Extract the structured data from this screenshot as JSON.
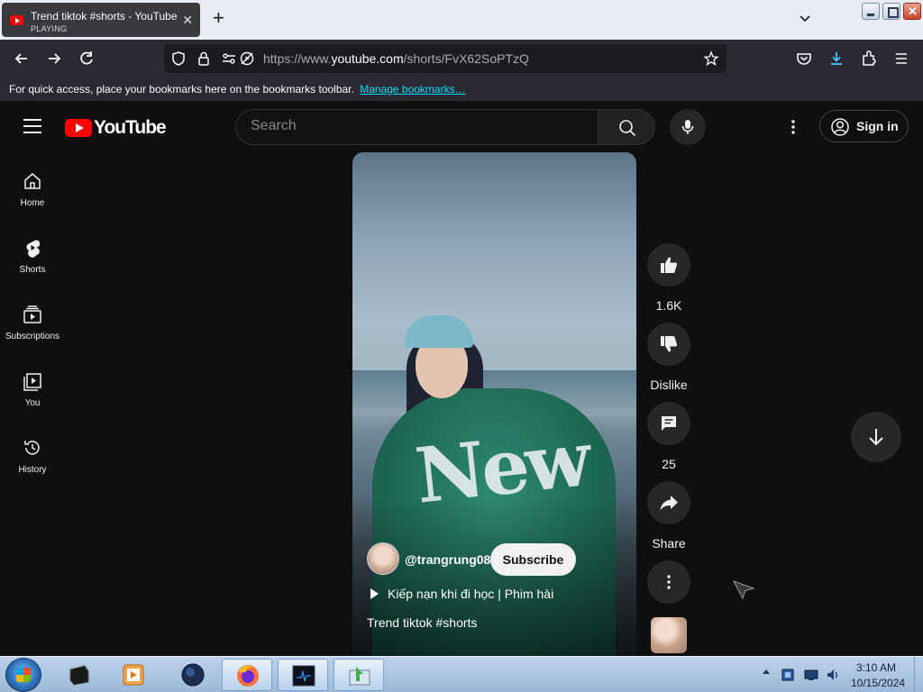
{
  "browser": {
    "tab": {
      "title": "Trend tiktok #shorts - YouTube",
      "status": "PLAYING"
    },
    "url": {
      "prefix": "https://www.",
      "host": "youtube.com",
      "path": "/shorts/FvX62SoPTzQ"
    },
    "bookmarks_bar": {
      "message": "For quick access, place your bookmarks here on the bookmarks toolbar.",
      "manage_link": "Manage bookmarks…"
    }
  },
  "youtube": {
    "logo": "YouTube",
    "search": {
      "placeholder": "Search"
    },
    "signin_label": "Sign in",
    "sidebar": [
      {
        "label": "Home",
        "icon": "home-icon"
      },
      {
        "label": "Shorts",
        "icon": "shorts-icon"
      },
      {
        "label": "Subscriptions",
        "icon": "subscriptions-icon"
      },
      {
        "label": "You",
        "icon": "you-icon"
      },
      {
        "label": "History",
        "icon": "history-icon"
      }
    ],
    "short": {
      "channel": "@trangrung08",
      "subscribe_label": "Subscribe",
      "sound": "Kiếp nạn khi đi học | Phim hài",
      "title": "Trend tiktok #shorts",
      "shirt_text": "New"
    },
    "actions": {
      "likes": "1.6K",
      "dislike_label": "Dislike",
      "comments": "25",
      "share_label": "Share"
    }
  },
  "taskbar": {
    "time": "3:10 AM",
    "date": "10/15/2024"
  },
  "colors": {
    "youtube_red": "#ff0000",
    "background": "#0f0f0f",
    "link": "#00ddff"
  }
}
